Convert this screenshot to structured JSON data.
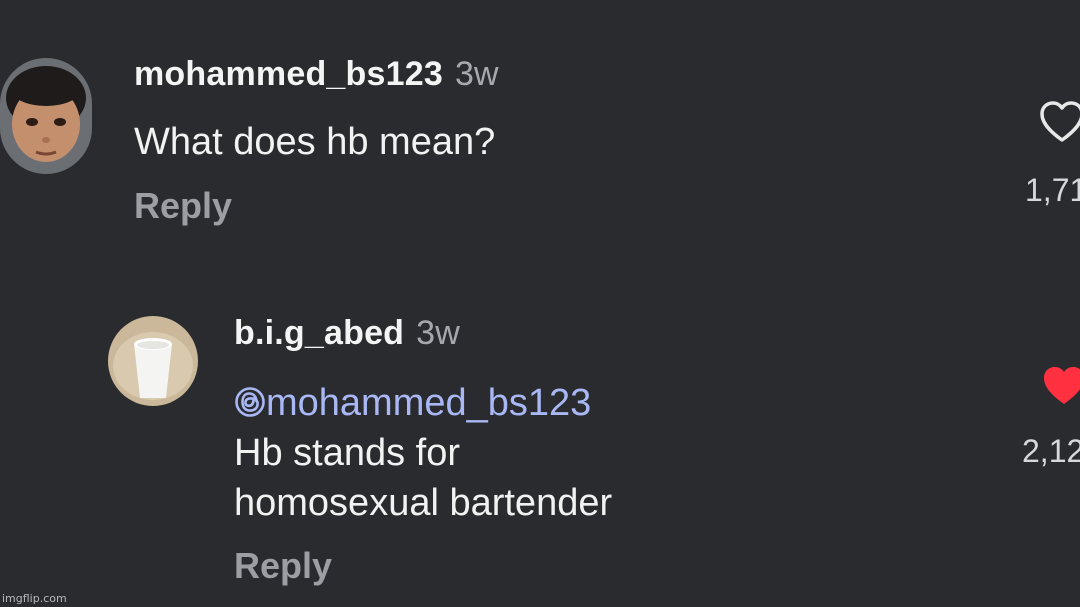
{
  "comments": [
    {
      "username": "mohammed_bs123",
      "time": "3w",
      "text": "What does hb mean?",
      "reply_label": "Reply",
      "likes": "1,71",
      "liked": false
    },
    {
      "username": "b.i.g_abed",
      "time": "3w",
      "mention_icon": "threads-at-icon",
      "mention": "mohammed_bs123",
      "text_line1": "Hb stands for",
      "text_line2": "homosexual bartender",
      "reply_label": "Reply",
      "likes": "2,12",
      "liked": true
    }
  ],
  "colors": {
    "background": "#2a2b2f",
    "mention": "#a9b8f5",
    "liked_heart": "#ff3040"
  },
  "watermark": "imgflip.com"
}
